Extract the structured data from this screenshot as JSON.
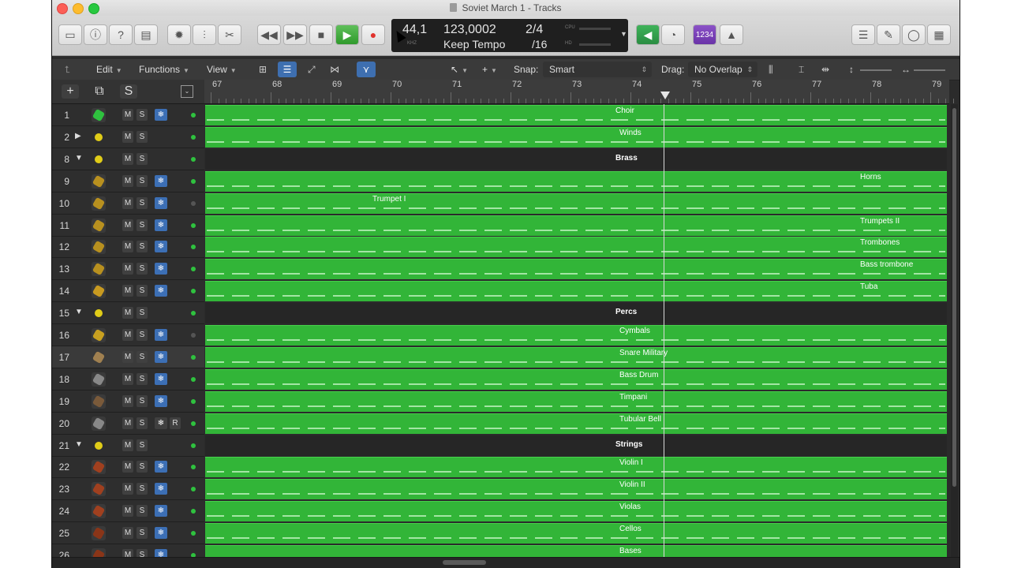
{
  "window": {
    "title": "Soviet March 1 - Tracks"
  },
  "control_bar": {
    "lcd": {
      "sample_rate": "44,1",
      "sample_unit": "KHZ",
      "tempo": "123,0002",
      "tempo_mode": "Keep Tempo",
      "signature_top": "2/4",
      "signature_bottom": "/16",
      "cpu_label": "CPU",
      "hd_label": "HD"
    },
    "count_in": "1234"
  },
  "edit_toolbar": {
    "edit": "Edit",
    "functions": "Functions",
    "view": "View",
    "snap_label": "Snap:",
    "snap_value": "Smart",
    "drag_label": "Drag:",
    "drag_value": "No Overlap"
  },
  "track_header": {
    "add_label": "+",
    "s_label": "S"
  },
  "ruler": {
    "bars": [
      "67",
      "68",
      "69",
      "70",
      "71",
      "72",
      "73",
      "74",
      "75",
      "76",
      "77",
      "78",
      "79"
    ]
  },
  "colors": {
    "region": "#32b538",
    "folder": "#262626",
    "accent_blue": "#3c6fb5"
  },
  "tracks": [
    {
      "num": "1",
      "type": "region",
      "name": "Choir",
      "icon": "choir-icon",
      "m": "M",
      "s": "S",
      "frozen": true,
      "dot": "green"
    },
    {
      "num": "2",
      "type": "region",
      "name": "Winds",
      "icon": "folder-icon",
      "m": "M",
      "s": "S",
      "dot": "green",
      "tri": "▶"
    },
    {
      "num": "8",
      "type": "folder",
      "name": "Brass",
      "icon": "folder-icon",
      "m": "M",
      "s": "S",
      "dot": "green",
      "tri": "▼"
    },
    {
      "num": "9",
      "type": "region",
      "name": "Horns",
      "icon": "horn-icon",
      "m": "M",
      "s": "S",
      "frozen": true,
      "dot": "green"
    },
    {
      "num": "10",
      "type": "region",
      "name": "Trumpet I",
      "icon": "trumpet-icon",
      "m": "M",
      "s": "S",
      "frozen": true,
      "dot": "dark"
    },
    {
      "num": "11",
      "type": "region",
      "name": "Trumpets II",
      "icon": "trumpet-icon",
      "m": "M",
      "s": "S",
      "frozen": true,
      "dot": "green"
    },
    {
      "num": "12",
      "type": "region",
      "name": "Trombones",
      "icon": "trombone-icon",
      "m": "M",
      "s": "S",
      "frozen": true,
      "dot": "green"
    },
    {
      "num": "13",
      "type": "region",
      "name": "Bass trombone",
      "icon": "trombone-icon",
      "m": "M",
      "s": "S",
      "frozen": true,
      "dot": "green"
    },
    {
      "num": "14",
      "type": "region",
      "name": "Tuba",
      "icon": "tuba-icon",
      "m": "M",
      "s": "S",
      "frozen": true,
      "dot": "green"
    },
    {
      "num": "15",
      "type": "folder",
      "name": "Percs",
      "icon": "folder-icon",
      "m": "M",
      "s": "S",
      "dot": "green",
      "tri": "▼"
    },
    {
      "num": "16",
      "type": "region",
      "name": "Cymbals",
      "icon": "cymbal-icon",
      "m": "M",
      "s": "S",
      "frozen": true,
      "dot": "dark"
    },
    {
      "num": "17",
      "type": "region",
      "name": "Snare Military",
      "icon": "snare-icon",
      "m": "M",
      "s": "S",
      "frozen": true,
      "dot": "green"
    },
    {
      "num": "18",
      "type": "region",
      "name": "Bass Drum",
      "icon": "bass-drum-icon",
      "m": "M",
      "s": "S",
      "frozen": true,
      "dot": "green"
    },
    {
      "num": "19",
      "type": "region",
      "name": "Timpani",
      "icon": "timpani-icon",
      "m": "M",
      "s": "S",
      "frozen": true,
      "dot": "green"
    },
    {
      "num": "20",
      "type": "region",
      "name": "Tubular Bell",
      "icon": "bell-icon",
      "m": "M",
      "s": "S",
      "frozen": true,
      "r": "R",
      "dot": "green"
    },
    {
      "num": "21",
      "type": "folder",
      "name": "Strings",
      "icon": "folder-icon",
      "m": "M",
      "s": "S",
      "dot": "green",
      "tri": "▼"
    },
    {
      "num": "22",
      "type": "region",
      "name": "Violin I",
      "icon": "violin-icon",
      "m": "M",
      "s": "S",
      "frozen": true,
      "dot": "green"
    },
    {
      "num": "23",
      "type": "region",
      "name": "Violin II",
      "icon": "violin-icon",
      "m": "M",
      "s": "S",
      "frozen": true,
      "dot": "green"
    },
    {
      "num": "24",
      "type": "region",
      "name": "Violas",
      "icon": "viola-icon",
      "m": "M",
      "s": "S",
      "frozen": true,
      "dot": "green"
    },
    {
      "num": "25",
      "type": "region",
      "name": "Cellos",
      "icon": "cello-icon",
      "m": "M",
      "s": "S",
      "frozen": true,
      "dot": "green"
    },
    {
      "num": "26",
      "type": "region",
      "name": "Bases",
      "icon": "bass-icon",
      "m": "M",
      "s": "S",
      "frozen": true,
      "dot": "green"
    }
  ]
}
